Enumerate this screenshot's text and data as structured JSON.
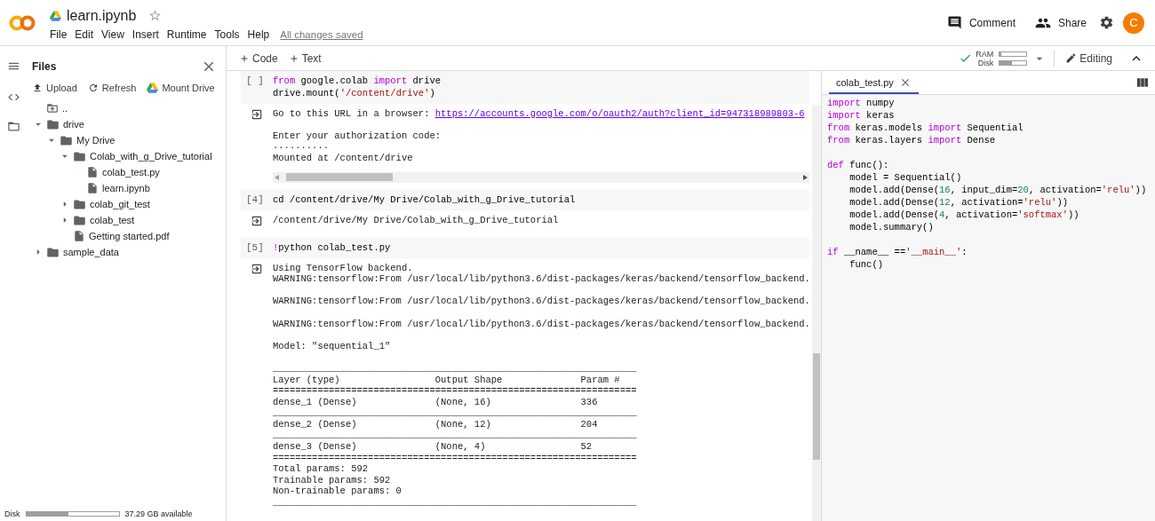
{
  "header": {
    "title": "learn.ipynb",
    "starred": false,
    "menu": [
      "File",
      "Edit",
      "View",
      "Insert",
      "Runtime",
      "Tools",
      "Help"
    ],
    "save_status": "All changes saved",
    "actions": [
      "Comment",
      "Share"
    ],
    "avatar": "C"
  },
  "sidebar": {
    "title": "Files",
    "actions": [
      "Upload",
      "Refresh",
      "Mount Drive"
    ],
    "tree": [
      {
        "name": "..",
        "kind": "parent"
      },
      {
        "name": "drive",
        "kind": "folder",
        "expanded": true,
        "children": [
          {
            "name": "My Drive",
            "kind": "folder",
            "expanded": true,
            "children": [
              {
                "name": "Colab_with_g_Drive_tutorial",
                "kind": "folder",
                "expanded": true,
                "children": [
                  {
                    "name": "colab_test.py",
                    "kind": "file"
                  },
                  {
                    "name": "learn.ipynb",
                    "kind": "file"
                  }
                ]
              },
              {
                "name": "colab_git_test",
                "kind": "folder",
                "expanded": false
              },
              {
                "name": "colab_test",
                "kind": "folder",
                "expanded": false
              },
              {
                "name": "Getting started.pdf",
                "kind": "file"
              }
            ]
          }
        ]
      },
      {
        "name": "sample_data",
        "kind": "folder",
        "expanded": false
      }
    ],
    "disk": {
      "label": "Disk",
      "level": 0.46,
      "reading": "37.29 GB available"
    }
  },
  "toolbar": {
    "add": [
      "Code",
      "Text"
    ],
    "resources": {
      "connected": true,
      "ram_label": "RAM",
      "ram": {
        "level": 0.05
      },
      "disk_label": "Disk",
      "disk": {
        "level": 0.45
      }
    },
    "mode": "Editing"
  },
  "cells": [
    {
      "prompt": "[ ]",
      "code": [
        [
          {
            "kind": "keyword",
            "text": "from"
          },
          {
            "kind": "plain",
            "text": " google.colab "
          },
          {
            "kind": "keyword",
            "text": "import"
          },
          {
            "kind": "plain",
            "text": " drive"
          }
        ],
        [
          {
            "kind": "plain",
            "text": "drive.mount("
          },
          {
            "kind": "string",
            "text": "'/content/drive'"
          },
          {
            "kind": "plain",
            "text": ")"
          }
        ]
      ],
      "output": {
        "scrollable": true,
        "blocks": [
          [
            {
              "text": "Go to this URL in a browser: ",
              "link": "https://accounts.google.com/o/oauth2/auth?client_id=947318989803-6"
            }
          ],
          [
            "Enter your authorization code:",
            "··········",
            "Mounted at /content/drive"
          ]
        ]
      }
    },
    {
      "prompt": "[4]",
      "code": [
        [
          {
            "kind": "plain",
            "text": "cd /content/drive/My Drive/Colab_with_g_Drive_tutorial"
          }
        ]
      ],
      "output": {
        "scrollable": false,
        "blocks": [
          [
            "/content/drive/My Drive/Colab_with_g_Drive_tutorial"
          ]
        ]
      }
    },
    {
      "prompt": "[5]",
      "code": [
        [
          {
            "kind": "keyword",
            "text": "!"
          },
          {
            "kind": "plain",
            "text": "python colab_test.py"
          }
        ]
      ],
      "output": {
        "scrollable": false,
        "blocks": [
          [
            "Using TensorFlow backend.",
            "WARNING:tensorflow:From /usr/local/lib/python3.6/dist-packages/keras/backend/tensorflow_backend."
          ],
          [
            "WARNING:tensorflow:From /usr/local/lib/python3.6/dist-packages/keras/backend/tensorflow_backend."
          ],
          [
            "WARNING:tensorflow:From /usr/local/lib/python3.6/dist-packages/keras/backend/tensorflow_backend."
          ],
          [
            "Model: \"sequential_1\""
          ],
          [
            "_________________________________________________________________",
            "Layer (type)                 Output Shape              Param #   ",
            "=================================================================",
            "dense_1 (Dense)              (None, 16)                336       ",
            "_________________________________________________________________",
            "dense_2 (Dense)              (None, 12)                204       ",
            "_________________________________________________________________",
            "dense_3 (Dense)              (None, 4)                 52        ",
            "=================================================================",
            "Total params: 592",
            "Trainable params: 592",
            "Non-trainable params: 0",
            "_________________________________________________________________"
          ]
        ]
      }
    }
  ],
  "editor": {
    "tabs": [
      {
        "label": "colab_test.py",
        "selected": true
      }
    ],
    "blocks": [
      [
        [
          {
            "kind": "keyword",
            "text": "import"
          },
          {
            "kind": "plain",
            "text": " numpy"
          }
        ],
        [
          {
            "kind": "keyword",
            "text": "import"
          },
          {
            "kind": "plain",
            "text": " keras"
          }
        ],
        [
          {
            "kind": "keyword",
            "text": "from"
          },
          {
            "kind": "plain",
            "text": " keras.models "
          },
          {
            "kind": "keyword",
            "text": "import"
          },
          {
            "kind": "plain",
            "text": " Sequential"
          }
        ],
        [
          {
            "kind": "keyword",
            "text": "from"
          },
          {
            "kind": "plain",
            "text": " keras.layers "
          },
          {
            "kind": "keyword",
            "text": "import"
          },
          {
            "kind": "plain",
            "text": " Dense"
          }
        ]
      ],
      [
        [
          {
            "kind": "keyword",
            "text": "def"
          },
          {
            "kind": "plain",
            "text": " func():"
          }
        ],
        [
          {
            "kind": "plain",
            "text": "    model = Sequential()"
          }
        ],
        [
          {
            "kind": "plain",
            "text": "    model.add(Dense("
          },
          {
            "kind": "number",
            "text": "16"
          },
          {
            "kind": "plain",
            "text": ", input_dim="
          },
          {
            "kind": "number",
            "text": "20"
          },
          {
            "kind": "plain",
            "text": ", activation="
          },
          {
            "kind": "string",
            "text": "'relu'"
          },
          {
            "kind": "plain",
            "text": "))"
          }
        ],
        [
          {
            "kind": "plain",
            "text": "    model.add(Dense("
          },
          {
            "kind": "number",
            "text": "12"
          },
          {
            "kind": "plain",
            "text": ", activation="
          },
          {
            "kind": "string",
            "text": "'relu'"
          },
          {
            "kind": "plain",
            "text": "))"
          }
        ],
        [
          {
            "kind": "plain",
            "text": "    model.add(Dense("
          },
          {
            "kind": "number",
            "text": "4"
          },
          {
            "kind": "plain",
            "text": ", activation="
          },
          {
            "kind": "string",
            "text": "'softmax'"
          },
          {
            "kind": "plain",
            "text": "))"
          }
        ],
        [
          {
            "kind": "plain",
            "text": "    model.summary()"
          }
        ]
      ],
      [
        [
          {
            "kind": "keyword",
            "text": "if"
          },
          {
            "kind": "plain",
            "text": " __name__ =="
          },
          {
            "kind": "string",
            "text": "'__main__'"
          },
          {
            "kind": "plain",
            "text": ":"
          }
        ],
        [
          {
            "kind": "plain",
            "text": "    func()"
          }
        ]
      ]
    ]
  }
}
